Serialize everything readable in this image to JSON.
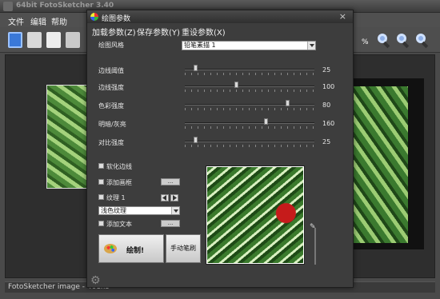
{
  "app": {
    "title": "64bit FotoSketcher 3.40",
    "menu": [
      "文件",
      "编辑",
      "帮助"
    ],
    "status": "FotoSketcher image - 461x5"
  },
  "dialog": {
    "title": "绘图参数",
    "close_glyph": "×",
    "menu": [
      "加载参数(Z)",
      "保存参数(Y)",
      "重设参数(X)"
    ],
    "style_label": "绘图风格",
    "style_value": "铅笔素描 1",
    "sliders": [
      {
        "label": "边线阈值",
        "value": "25",
        "fraction": 0.08
      },
      {
        "label": "边线强度",
        "value": "100",
        "fraction": 0.4
      },
      {
        "label": "色彩强度",
        "value": "80",
        "fraction": 0.8
      },
      {
        "label": "明暗/灰亮",
        "value": "160",
        "fraction": 0.63
      },
      {
        "label": "对比强度",
        "value": "25",
        "fraction": 0.08
      }
    ],
    "checks": {
      "soften_edges": "软化边线",
      "add_frame": "添加画框",
      "texture": "纹理 1",
      "add_text": "添加文本"
    },
    "browse_label": "...",
    "texture_select": "浅色纹理",
    "draw_button": "绘制!",
    "manual_button": "手动笔刷",
    "partial_percent": "%"
  }
}
